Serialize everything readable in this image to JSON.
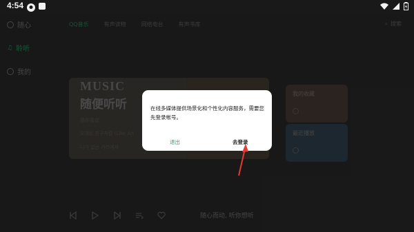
{
  "status_bar": {
    "time": "4:54",
    "icons": [
      "notification-icon",
      "app-square-icon",
      "wifi-icon",
      "cellular-icon",
      "battery-icon"
    ]
  },
  "sidebar": {
    "items": [
      {
        "label": "随心",
        "icon": "sparkle-icon"
      },
      {
        "label": "聆听",
        "icon": "listen-icon"
      },
      {
        "label": "我的",
        "icon": "profile-icon"
      }
    ]
  },
  "top_tabs": {
    "items": [
      "QQ音乐",
      "有声读物",
      "网络电台",
      "有声书库"
    ],
    "search_label": "搜索"
  },
  "hero": {
    "music": "MUSIC",
    "slogan": "随便听听",
    "line1": "猜你喜欢",
    "line2": "오래된 친구처럼 (Like An",
    "line3": "니가 없는 거리에서"
  },
  "cards": {
    "favorites_label": "我的收藏",
    "recent_label": "最近播放"
  },
  "player": {
    "song_text": "随心而动, 听你想听"
  },
  "dialog": {
    "message": "在线多媒体提供场景化和个性化内容服务，需要您先登录帐号。",
    "cancel_label": "退出",
    "confirm_label": "去登录"
  },
  "colors": {
    "accent": "#2e9e6a",
    "annotation_arrow": "#e53935",
    "dialog_bg": "#ffffff"
  }
}
